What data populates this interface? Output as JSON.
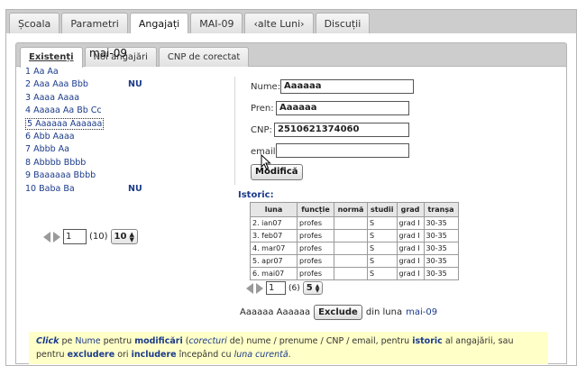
{
  "top_tabs": [
    "Școala",
    "Parametri",
    "Angajați",
    "MAI-09",
    "‹alte Luni›",
    "Discuții"
  ],
  "inner_tabs": [
    "Existenți",
    "Noi angajări",
    "CNP de corectat"
  ],
  "month_title": "mai-09",
  "employees": [
    {
      "label": "1 Aa Aa",
      "badge": ""
    },
    {
      "label": "2 Aaa Aaa Bbb",
      "badge": "NU"
    },
    {
      "label": "3 Aaaa Aaaa",
      "badge": ""
    },
    {
      "label": "4 Aaaaa Aa Bb Cc",
      "badge": ""
    },
    {
      "label": "5 Aaaaaa Aaaaaa",
      "badge": ""
    },
    {
      "label": "6 Abb Aaaa",
      "badge": ""
    },
    {
      "label": "7 Abbb Aa",
      "badge": ""
    },
    {
      "label": "8 Abbbb Bbbb",
      "badge": ""
    },
    {
      "label": "9 Baaaaaa Bbbb",
      "badge": ""
    },
    {
      "label": "10 Baba Ba",
      "badge": "NU"
    }
  ],
  "list_pager": {
    "page": "1",
    "total": "(10)",
    "per_page": "10"
  },
  "form": {
    "nume_label": "Nume:",
    "nume_value": "Aaaaaa",
    "pren_label": "Pren:",
    "pren_value": "Aaaaaa",
    "cnp_label": "CNP:",
    "cnp_value": "2510621374060",
    "email_label": "email:",
    "email_value": "",
    "submit_label": "Modifică"
  },
  "istoric_label": "Istoric:",
  "history_table": {
    "headers": [
      "luna",
      "funcție",
      "normă",
      "studii",
      "grad",
      "tranșa"
    ],
    "rows": [
      [
        "2. ian07",
        "profes",
        "",
        "S",
        "grad I",
        "30-35"
      ],
      [
        "3. feb07",
        "profes",
        "",
        "S",
        "grad I",
        "30-35"
      ],
      [
        "4. mar07",
        "profes",
        "",
        "S",
        "grad I",
        "30-35"
      ],
      [
        "5. apr07",
        "profes",
        "",
        "S",
        "grad I",
        "30-35"
      ],
      [
        "6. mai07",
        "profes",
        "",
        "S",
        "grad I",
        "30-35"
      ]
    ]
  },
  "history_pager": {
    "page": "1",
    "total": "(6)",
    "per_page": "5"
  },
  "exclude": {
    "name": "Aaaaaa Aaaaaa",
    "button": "Exclude",
    "suffix": "din luna",
    "month": "mai-09"
  },
  "hint": {
    "w1": "Click",
    "w2": " pe ",
    "w3": "Nume",
    "w4": " pentru ",
    "w5": "modificări",
    "w6": " (",
    "w7": "corecturi",
    "w8": " de) nume / prenume / CNP / email, pentru ",
    "w9": "istoric",
    "w10": " al angajării, sau",
    "w11": "pentru ",
    "w12": "excludere",
    "w13": " ori ",
    "w14": "includere",
    "w15": " începând cu ",
    "w16": "luna curentă",
    "w17": "."
  }
}
